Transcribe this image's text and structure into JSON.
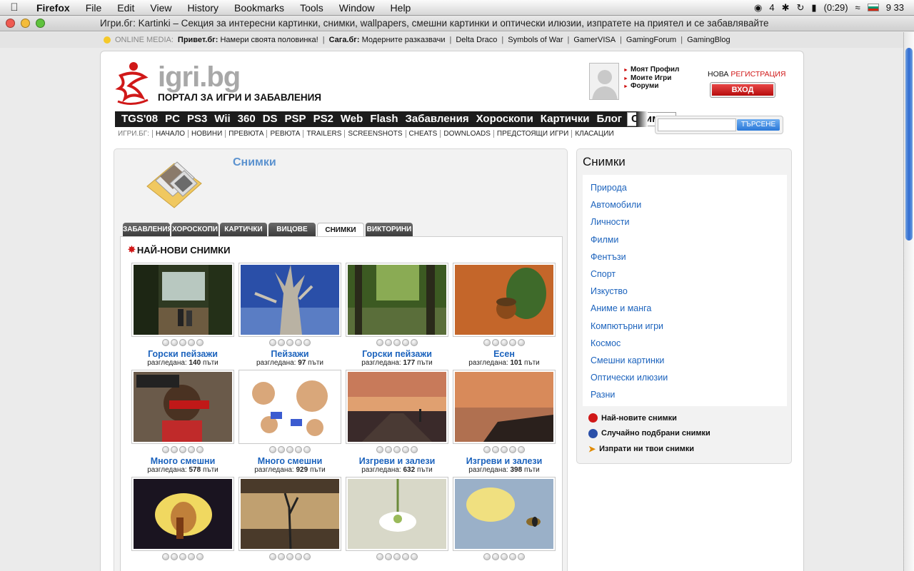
{
  "menubar": {
    "app": "Firefox",
    "items": [
      "File",
      "Edit",
      "View",
      "History",
      "Bookmarks",
      "Tools",
      "Window",
      "Help"
    ],
    "status_count": "4",
    "battery": "(0:29)",
    "clock": "9 33"
  },
  "window": {
    "title": "Игри.бг: Kartinki – Секция за интересни картинки, снимки, wallpapers, смешни картинки и оптически илюзии, изпратете на приятел и се забавлявайте"
  },
  "bookmarks": [
    {
      "label": "ONLINE MEDIA:",
      "strong": "",
      "text": ""
    },
    {
      "label": "",
      "strong": "Привет.бг:",
      "text": "Намери своята половинка!"
    },
    {
      "label": "",
      "strong": "Сага.бг:",
      "text": "Модерните разказвачи"
    },
    {
      "label": "Delta Draco",
      "strong": "",
      "text": ""
    },
    {
      "label": "Symbols of War",
      "strong": "",
      "text": ""
    },
    {
      "label": "GamerVISA",
      "strong": "",
      "text": ""
    },
    {
      "label": "GamingForum",
      "strong": "",
      "text": ""
    },
    {
      "label": "GamingBlog",
      "strong": "",
      "text": ""
    }
  ],
  "header": {
    "brand": "igri.bg",
    "tagline": "ПОРТАЛ ЗА ИГРИ И ЗАБАВЛЕНИЯ",
    "user_links": [
      "Моят Профил",
      "Моите Игри",
      "Форуми"
    ],
    "register_prefix": "НОВА",
    "register_highlight": "РЕГИСТРАЦИЯ",
    "login": "ВХОД",
    "search_value": "",
    "search_button": "ТЪРСЕНЕ"
  },
  "mainnav": [
    "TGS'08",
    "PC",
    "PS3",
    "Wii",
    "360",
    "DS",
    "PSP",
    "PS2",
    "Web",
    "Flash",
    "Забавления",
    "Хороскопи",
    "Картички",
    "Блог",
    "Снимки"
  ],
  "mainnav_active": "Снимки",
  "subnav": [
    "ИГРИ.БГ:",
    "НАЧАЛО",
    "НОВИНИ",
    "ПРЕВЮТА",
    "РЕВЮТА",
    "TRAILERS",
    "SCREENSHOTS",
    "CHEATS",
    "DOWNLOADS",
    "ПРЕДСТОЯЩИ ИГРИ",
    "КЛАСАЦИИ"
  ],
  "section": {
    "title": "Снимки",
    "tabs": [
      {
        "label": "ЗАБАВЛЕНИЯ",
        "active": false
      },
      {
        "label": "ХОРОСКОПИ",
        "active": false
      },
      {
        "label": "КАРТИЧКИ",
        "active": false
      },
      {
        "label": "ВИЦОВЕ",
        "active": false
      },
      {
        "label": "СНИМКИ",
        "active": true
      },
      {
        "label": "ВИКТОРИНИ",
        "active": false
      }
    ],
    "gallery_title": "НАЙ-НОВИ СНИМКИ",
    "views_label": "разгледана:",
    "views_suffix": "пъти",
    "items": [
      {
        "title": "Горски пейзажи",
        "views": "140",
        "scene": "forest-path"
      },
      {
        "title": "Пейзажи",
        "views": "97",
        "scene": "dead-tree"
      },
      {
        "title": "Горски пейзажи",
        "views": "177",
        "scene": "forest-green"
      },
      {
        "title": "Есен",
        "views": "101",
        "scene": "autumn-leaf"
      },
      {
        "title": "Много смешни",
        "views": "578",
        "scene": "funny-poster"
      },
      {
        "title": "Много смешни",
        "views": "929",
        "scene": "cartoon-bears"
      },
      {
        "title": "Изгреви и залези",
        "views": "632",
        "scene": "pier-sunset"
      },
      {
        "title": "Изгреви и залези",
        "views": "398",
        "scene": "coast-sunset"
      },
      {
        "title": "",
        "views": "",
        "scene": "calla-flower"
      },
      {
        "title": "",
        "views": "",
        "scene": "grass-sunset"
      },
      {
        "title": "",
        "views": "",
        "scene": "snowdrop"
      },
      {
        "title": "",
        "views": "",
        "scene": "bee-flower"
      }
    ]
  },
  "sidebar": {
    "title": "Снимки",
    "categories": [
      "Природа",
      "Автомобили",
      "Личности",
      "Филми",
      "Фентъзи",
      "Спорт",
      "Изкуство",
      "Аниме и манга",
      "Компютърни игри",
      "Космос",
      "Смешни картинки",
      "Оптически илюзии",
      "Разни"
    ],
    "links": [
      {
        "label": "Най-новите снимки",
        "icon": "new-badge-icon"
      },
      {
        "label": "Случайно подбрани снимки",
        "icon": "random-icon"
      },
      {
        "label": "Изпрати ни твои снимки",
        "icon": "send-arrow-icon"
      }
    ]
  },
  "colors": {
    "accent_red": "#d01818",
    "link_blue": "#1c63bd",
    "section_blue": "#5b92cf",
    "nav_dark": "#1c1c1c"
  }
}
